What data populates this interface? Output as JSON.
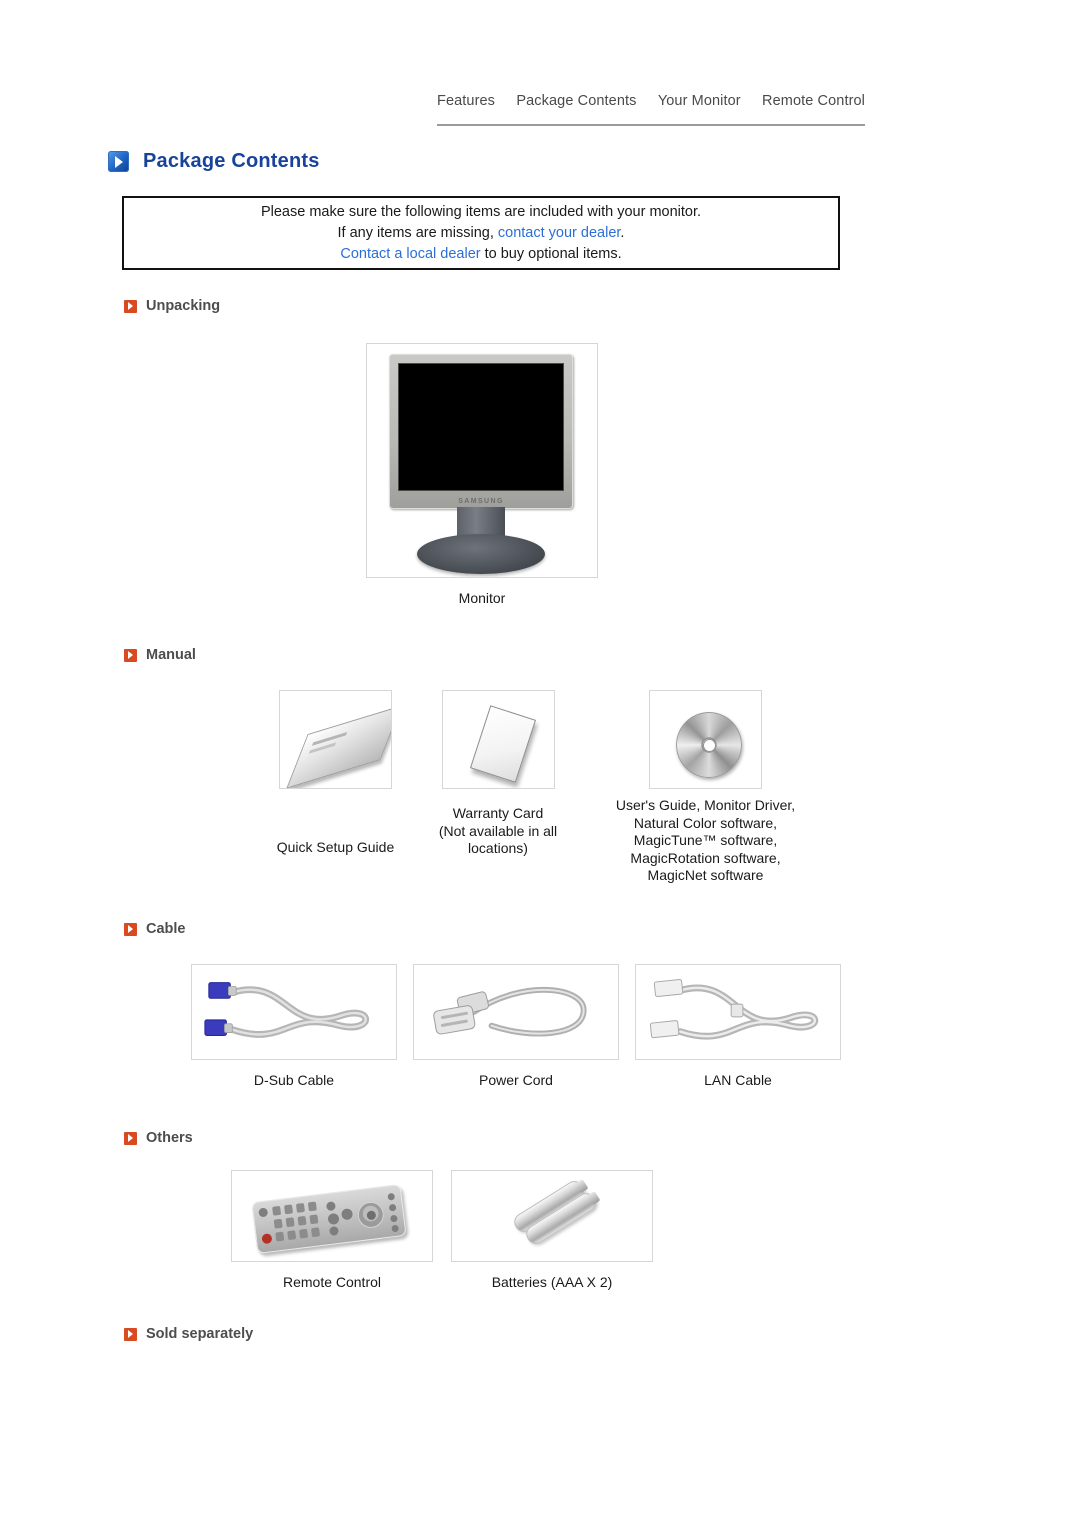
{
  "nav": {
    "tabs": [
      {
        "label": "Features"
      },
      {
        "label": "Package Contents"
      },
      {
        "label": "Your Monitor"
      },
      {
        "label": "Remote Control"
      }
    ]
  },
  "header": {
    "title": "Package Contents",
    "icon": "blue-arrow-icon",
    "accent_color": "#17439b"
  },
  "notice": {
    "line1": "Please make sure the following items are included with your monitor.",
    "line2_prefix": "If any items are missing, ",
    "line2_link": "contact your dealer",
    "line2_suffix": ".",
    "line3_link": "Contact a local dealer",
    "line3_suffix": " to buy optional items.",
    "link_color": "#2b6fd6"
  },
  "sections": [
    {
      "id": "unpacking",
      "label": "Unpacking",
      "bullet_color": "#d94a20",
      "items": [
        {
          "id": "monitor",
          "caption": "Monitor",
          "image": "monitor-photo"
        }
      ]
    },
    {
      "id": "manual",
      "label": "Manual",
      "bullet_color": "#d94a20",
      "items": [
        {
          "id": "quick-setup-guide",
          "caption": "Quick Setup Guide",
          "image": "booklet-photo"
        },
        {
          "id": "warranty-card",
          "caption": "Warranty Card\n(Not available in all\nlocations)",
          "image": "card-photo"
        },
        {
          "id": "software-cd",
          "caption": "User's Guide, Monitor Driver,\nNatural Color software,\nMagicTune™ software,\nMagicRotation software,\nMagicNet software",
          "image": "cd-photo"
        }
      ]
    },
    {
      "id": "cable",
      "label": "Cable",
      "bullet_color": "#d94a20",
      "items": [
        {
          "id": "d-sub-cable",
          "caption": "D-Sub Cable",
          "image": "d-sub-cable-photo"
        },
        {
          "id": "power-cord",
          "caption": "Power Cord",
          "image": "power-cord-photo"
        },
        {
          "id": "lan-cable",
          "caption": "LAN Cable",
          "image": "lan-cable-photo"
        }
      ]
    },
    {
      "id": "others",
      "label": "Others",
      "bullet_color": "#d94a20",
      "items": [
        {
          "id": "remote-control",
          "caption": "Remote Control",
          "image": "remote-control-photo"
        },
        {
          "id": "batteries",
          "caption": "Batteries (AAA X 2)",
          "image": "batteries-photo"
        }
      ]
    },
    {
      "id": "sold-separately",
      "label": "Sold separately",
      "bullet_color": "#d94a20",
      "items": []
    }
  ]
}
